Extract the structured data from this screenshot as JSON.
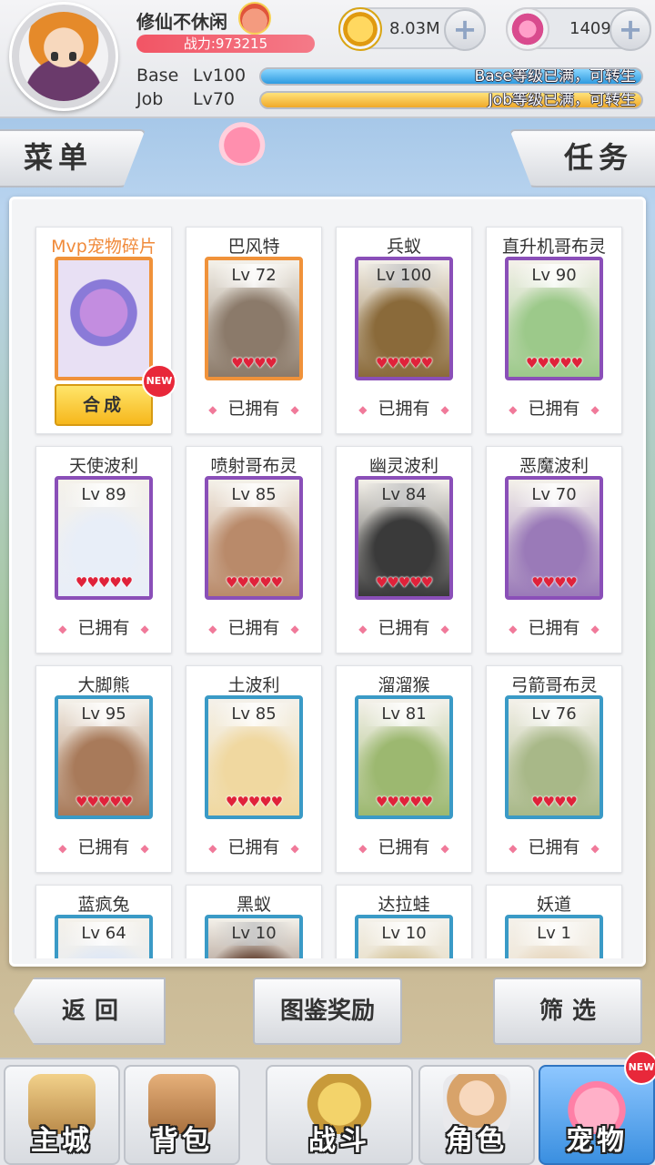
{
  "player": {
    "name": "修仙不休闲",
    "power": "战力:973215",
    "base_label": "Base",
    "base_level": "Lv100",
    "base_status": "Base等级已满，可转生",
    "job_label": "Job",
    "job_level": "Lv70",
    "job_status": "Job等级已满，可转生"
  },
  "resources": {
    "coins": "8.03M",
    "gems": "1409",
    "plus": "+"
  },
  "tabs": {
    "menu": "菜单",
    "task": "任务"
  },
  "craft": {
    "title": "Mvp宠物碎片",
    "button": "合成",
    "badge": "NEW"
  },
  "owned_label": "已拥有",
  "diamond": "◆",
  "pets": [
    {
      "name": "巴风特",
      "level": "Lv 72",
      "hearts": "♥♥♥♥",
      "frame": "orange",
      "art": "#8b7a6a"
    },
    {
      "name": "兵蚁",
      "level": "Lv 100",
      "hearts": "♥♥♥♥♥",
      "frame": "purple",
      "art": "#8a6a3a"
    },
    {
      "name": "直升机哥布灵",
      "level": "Lv 90",
      "hearts": "♥♥♥♥♥",
      "frame": "purple",
      "art": "#9cc98a"
    },
    {
      "name": "天使波利",
      "level": "Lv 89",
      "hearts": "♥♥♥♥♥",
      "frame": "purple",
      "art": "#e8eef8"
    },
    {
      "name": "喷射哥布灵",
      "level": "Lv 85",
      "hearts": "♥♥♥♥♥",
      "frame": "purple",
      "art": "#b98a6a"
    },
    {
      "name": "幽灵波利",
      "level": "Lv 84",
      "hearts": "♥♥♥♥♥",
      "frame": "purple",
      "art": "#3a3a3a"
    },
    {
      "name": "恶魔波利",
      "level": "Lv 70",
      "hearts": "♥♥♥♥",
      "frame": "purple",
      "art": "#9a7ab8"
    },
    {
      "name": "大脚熊",
      "level": "Lv 95",
      "hearts": "♥♥♥♥♥",
      "frame": "teal",
      "art": "#a87a5a"
    },
    {
      "name": "土波利",
      "level": "Lv 85",
      "hearts": "♥♥♥♥♥",
      "frame": "teal",
      "art": "#f0d8a0"
    },
    {
      "name": "溜溜猴",
      "level": "Lv 81",
      "hearts": "♥♥♥♥♥",
      "frame": "teal",
      "art": "#9cb870"
    },
    {
      "name": "弓箭哥布灵",
      "level": "Lv 76",
      "hearts": "♥♥♥♥",
      "frame": "teal",
      "art": "#a8b888"
    },
    {
      "name": "蓝疯兔",
      "level": "Lv 64",
      "hearts": "",
      "frame": "teal",
      "art": "#dfe8f6"
    },
    {
      "name": "黑蚁",
      "level": "Lv 10",
      "hearts": "",
      "frame": "teal",
      "art": "#6a4a3a"
    },
    {
      "name": "达拉蛙",
      "level": "Lv 10",
      "hearts": "",
      "frame": "teal",
      "art": "#d8c8a0"
    },
    {
      "name": "妖道",
      "level": "Lv 1",
      "hearts": "",
      "frame": "teal",
      "art": "#e8d8c0"
    }
  ],
  "bottom_buttons": {
    "back": "返回",
    "album_reward": "图鉴奖励",
    "filter": "筛选"
  },
  "nav": {
    "city": "主城",
    "bag": "背包",
    "battle": "战斗",
    "role": "角色",
    "pet": "宠物",
    "pet_badge": "NEW"
  }
}
